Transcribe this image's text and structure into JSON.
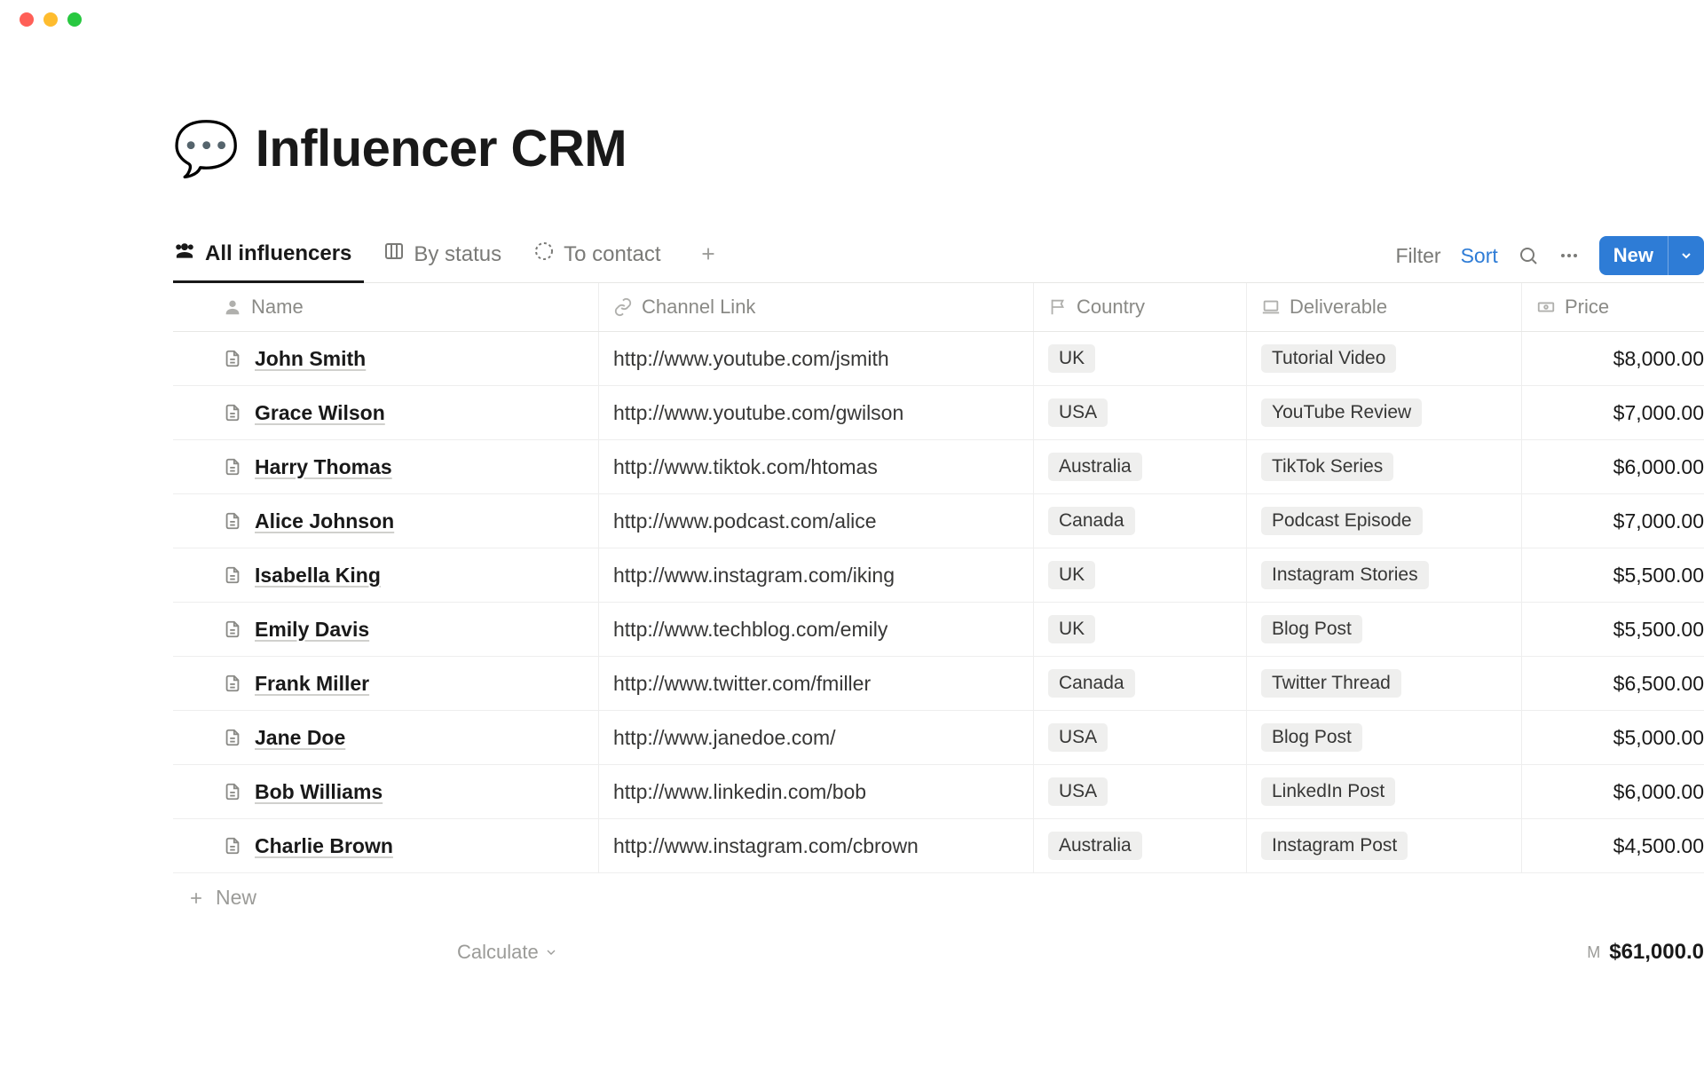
{
  "window": {
    "title": "Influencer CRM"
  },
  "page": {
    "icon": "💬",
    "title": "Influencer CRM"
  },
  "views": {
    "tabs": [
      {
        "label": "All influencers",
        "icon": "people",
        "active": true
      },
      {
        "label": "By status",
        "icon": "board",
        "active": false
      },
      {
        "label": "To contact",
        "icon": "dashed-circle",
        "active": false
      }
    ]
  },
  "controls": {
    "filter": "Filter",
    "sort": "Sort",
    "new": "New"
  },
  "columns": {
    "name": "Name",
    "channel": "Channel Link",
    "country": "Country",
    "deliverable": "Deliverable",
    "price": "Price"
  },
  "rows": [
    {
      "name": "John Smith",
      "channel": "http://www.youtube.com/jsmith",
      "country": "UK",
      "deliverable": "Tutorial Video",
      "price": "$8,000.00"
    },
    {
      "name": "Grace Wilson",
      "channel": "http://www.youtube.com/gwilson",
      "country": "USA",
      "deliverable": "YouTube Review",
      "price": "$7,000.00"
    },
    {
      "name": "Harry Thomas",
      "channel": "http://www.tiktok.com/htomas",
      "country": "Australia",
      "deliverable": "TikTok Series",
      "price": "$6,000.00"
    },
    {
      "name": "Alice Johnson",
      "channel": "http://www.podcast.com/alice",
      "country": "Canada",
      "deliverable": "Podcast Episode",
      "price": "$7,000.00"
    },
    {
      "name": "Isabella King",
      "channel": "http://www.instagram.com/iking",
      "country": "UK",
      "deliverable": "Instagram Stories",
      "price": "$5,500.00"
    },
    {
      "name": "Emily Davis",
      "channel": "http://www.techblog.com/emily",
      "country": "UK",
      "deliverable": "Blog Post",
      "price": "$5,500.00"
    },
    {
      "name": "Frank Miller",
      "channel": "http://www.twitter.com/fmiller",
      "country": "Canada",
      "deliverable": "Twitter Thread",
      "price": "$6,500.00"
    },
    {
      "name": "Jane Doe",
      "channel": "http://www.janedoe.com/",
      "country": "USA",
      "deliverable": "Blog Post",
      "price": "$5,000.00"
    },
    {
      "name": "Bob Williams",
      "channel": "http://www.linkedin.com/bob",
      "country": "USA",
      "deliverable": "LinkedIn Post",
      "price": "$6,000.00"
    },
    {
      "name": "Charlie Brown",
      "channel": "http://www.instagram.com/cbrown",
      "country": "Australia",
      "deliverable": "Instagram Post",
      "price": "$4,500.00"
    }
  ],
  "footer": {
    "new_row": "New",
    "calculate": "Calculate",
    "sum_label": "M",
    "sum_value": "$61,000.0"
  }
}
